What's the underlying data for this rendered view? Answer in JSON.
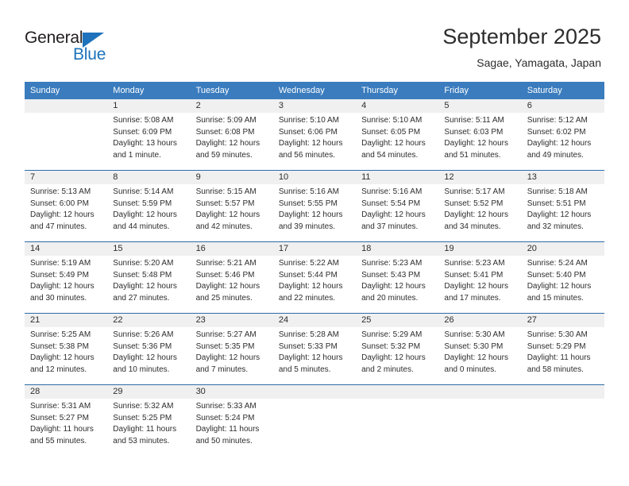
{
  "brand": {
    "name_top": "General",
    "name_bottom": "Blue",
    "accent_color": "#1e72bb"
  },
  "header": {
    "title": "September 2025",
    "location": "Sagae, Yamagata, Japan"
  },
  "theme": {
    "header_row_bg": "#3a7cbe",
    "daynum_band_bg": "#f0f0f0",
    "week_divider": "#2c6ca8",
    "text": "#2d2d2d"
  },
  "weekdays": [
    "Sunday",
    "Monday",
    "Tuesday",
    "Wednesday",
    "Thursday",
    "Friday",
    "Saturday"
  ],
  "weeks": [
    [
      {
        "day": "",
        "lines": [
          "",
          "",
          "",
          ""
        ]
      },
      {
        "day": "1",
        "lines": [
          "Sunrise: 5:08 AM",
          "Sunset: 6:09 PM",
          "Daylight: 13 hours",
          "and 1 minute."
        ]
      },
      {
        "day": "2",
        "lines": [
          "Sunrise: 5:09 AM",
          "Sunset: 6:08 PM",
          "Daylight: 12 hours",
          "and 59 minutes."
        ]
      },
      {
        "day": "3",
        "lines": [
          "Sunrise: 5:10 AM",
          "Sunset: 6:06 PM",
          "Daylight: 12 hours",
          "and 56 minutes."
        ]
      },
      {
        "day": "4",
        "lines": [
          "Sunrise: 5:10 AM",
          "Sunset: 6:05 PM",
          "Daylight: 12 hours",
          "and 54 minutes."
        ]
      },
      {
        "day": "5",
        "lines": [
          "Sunrise: 5:11 AM",
          "Sunset: 6:03 PM",
          "Daylight: 12 hours",
          "and 51 minutes."
        ]
      },
      {
        "day": "6",
        "lines": [
          "Sunrise: 5:12 AM",
          "Sunset: 6:02 PM",
          "Daylight: 12 hours",
          "and 49 minutes."
        ]
      }
    ],
    [
      {
        "day": "7",
        "lines": [
          "Sunrise: 5:13 AM",
          "Sunset: 6:00 PM",
          "Daylight: 12 hours",
          "and 47 minutes."
        ]
      },
      {
        "day": "8",
        "lines": [
          "Sunrise: 5:14 AM",
          "Sunset: 5:59 PM",
          "Daylight: 12 hours",
          "and 44 minutes."
        ]
      },
      {
        "day": "9",
        "lines": [
          "Sunrise: 5:15 AM",
          "Sunset: 5:57 PM",
          "Daylight: 12 hours",
          "and 42 minutes."
        ]
      },
      {
        "day": "10",
        "lines": [
          "Sunrise: 5:16 AM",
          "Sunset: 5:55 PM",
          "Daylight: 12 hours",
          "and 39 minutes."
        ]
      },
      {
        "day": "11",
        "lines": [
          "Sunrise: 5:16 AM",
          "Sunset: 5:54 PM",
          "Daylight: 12 hours",
          "and 37 minutes."
        ]
      },
      {
        "day": "12",
        "lines": [
          "Sunrise: 5:17 AM",
          "Sunset: 5:52 PM",
          "Daylight: 12 hours",
          "and 34 minutes."
        ]
      },
      {
        "day": "13",
        "lines": [
          "Sunrise: 5:18 AM",
          "Sunset: 5:51 PM",
          "Daylight: 12 hours",
          "and 32 minutes."
        ]
      }
    ],
    [
      {
        "day": "14",
        "lines": [
          "Sunrise: 5:19 AM",
          "Sunset: 5:49 PM",
          "Daylight: 12 hours",
          "and 30 minutes."
        ]
      },
      {
        "day": "15",
        "lines": [
          "Sunrise: 5:20 AM",
          "Sunset: 5:48 PM",
          "Daylight: 12 hours",
          "and 27 minutes."
        ]
      },
      {
        "day": "16",
        "lines": [
          "Sunrise: 5:21 AM",
          "Sunset: 5:46 PM",
          "Daylight: 12 hours",
          "and 25 minutes."
        ]
      },
      {
        "day": "17",
        "lines": [
          "Sunrise: 5:22 AM",
          "Sunset: 5:44 PM",
          "Daylight: 12 hours",
          "and 22 minutes."
        ]
      },
      {
        "day": "18",
        "lines": [
          "Sunrise: 5:23 AM",
          "Sunset: 5:43 PM",
          "Daylight: 12 hours",
          "and 20 minutes."
        ]
      },
      {
        "day": "19",
        "lines": [
          "Sunrise: 5:23 AM",
          "Sunset: 5:41 PM",
          "Daylight: 12 hours",
          "and 17 minutes."
        ]
      },
      {
        "day": "20",
        "lines": [
          "Sunrise: 5:24 AM",
          "Sunset: 5:40 PM",
          "Daylight: 12 hours",
          "and 15 minutes."
        ]
      }
    ],
    [
      {
        "day": "21",
        "lines": [
          "Sunrise: 5:25 AM",
          "Sunset: 5:38 PM",
          "Daylight: 12 hours",
          "and 12 minutes."
        ]
      },
      {
        "day": "22",
        "lines": [
          "Sunrise: 5:26 AM",
          "Sunset: 5:36 PM",
          "Daylight: 12 hours",
          "and 10 minutes."
        ]
      },
      {
        "day": "23",
        "lines": [
          "Sunrise: 5:27 AM",
          "Sunset: 5:35 PM",
          "Daylight: 12 hours",
          "and 7 minutes."
        ]
      },
      {
        "day": "24",
        "lines": [
          "Sunrise: 5:28 AM",
          "Sunset: 5:33 PM",
          "Daylight: 12 hours",
          "and 5 minutes."
        ]
      },
      {
        "day": "25",
        "lines": [
          "Sunrise: 5:29 AM",
          "Sunset: 5:32 PM",
          "Daylight: 12 hours",
          "and 2 minutes."
        ]
      },
      {
        "day": "26",
        "lines": [
          "Sunrise: 5:30 AM",
          "Sunset: 5:30 PM",
          "Daylight: 12 hours",
          "and 0 minutes."
        ]
      },
      {
        "day": "27",
        "lines": [
          "Sunrise: 5:30 AM",
          "Sunset: 5:29 PM",
          "Daylight: 11 hours",
          "and 58 minutes."
        ]
      }
    ],
    [
      {
        "day": "28",
        "lines": [
          "Sunrise: 5:31 AM",
          "Sunset: 5:27 PM",
          "Daylight: 11 hours",
          "and 55 minutes."
        ]
      },
      {
        "day": "29",
        "lines": [
          "Sunrise: 5:32 AM",
          "Sunset: 5:25 PM",
          "Daylight: 11 hours",
          "and 53 minutes."
        ]
      },
      {
        "day": "30",
        "lines": [
          "Sunrise: 5:33 AM",
          "Sunset: 5:24 PM",
          "Daylight: 11 hours",
          "and 50 minutes."
        ]
      },
      {
        "day": "",
        "lines": [
          "",
          "",
          "",
          ""
        ]
      },
      {
        "day": "",
        "lines": [
          "",
          "",
          "",
          ""
        ]
      },
      {
        "day": "",
        "lines": [
          "",
          "",
          "",
          ""
        ]
      },
      {
        "day": "",
        "lines": [
          "",
          "",
          "",
          ""
        ]
      }
    ]
  ]
}
